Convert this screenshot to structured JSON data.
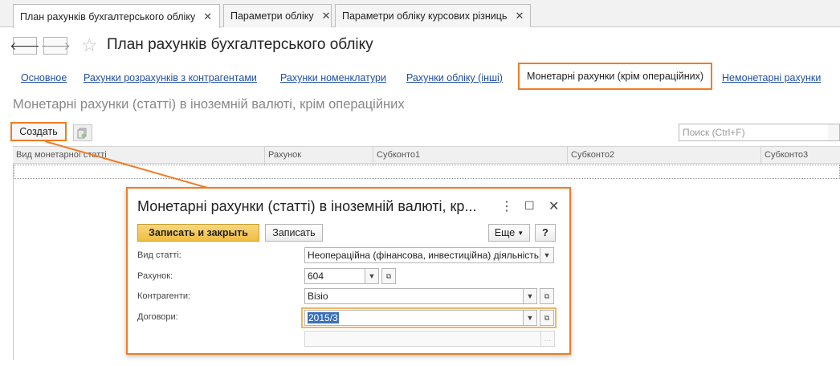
{
  "tabs": [
    {
      "label": "План рахунків бухгалтерського обліку",
      "active": true
    },
    {
      "label": "Параметри обліку",
      "active": false
    },
    {
      "label": "Параметри обліку курсових різниць",
      "active": false
    }
  ],
  "header": {
    "back_icon": "arrow-left-icon",
    "forward_icon": "arrow-right-icon",
    "favorite_icon": "star-icon",
    "title": "План рахунків бухгалтерського обліку"
  },
  "links": [
    "Основное",
    "Рахунки розрахунків з контрагентами",
    "Рахунки номенклатури",
    "Рахунки обліку (інші)",
    "Монетарні рахунки (крім операційних)",
    "Немонетарні рахунки"
  ],
  "section_title": "Монетарні рахунки (статті) в іноземній валюті, крім операційних",
  "toolbar": {
    "create_label": "Создать",
    "search_placeholder": "Поиск (Ctrl+F)"
  },
  "table": {
    "columns": [
      "Вид монетарної статті",
      "Рахунок",
      "Субконто1",
      "Субконто2",
      "Субконто3"
    ]
  },
  "dialog": {
    "title": "Монетарні рахунки (статті) в іноземній валюті, кр...",
    "more_icon": "kebab-menu-icon",
    "maximize_icon": "maximize-icon",
    "close_icon": "close-icon",
    "save_close_label": "Записать и закрыть",
    "save_label": "Записать",
    "more_label": "Еще",
    "help_label": "?",
    "fields": {
      "kind_label": "Вид статті:",
      "kind_value": "Неопераційна (фінансова, инвестиційна) діяльність",
      "account_label": "Рахунок:",
      "account_value": "604",
      "counterparty_label": "Контрагенти:",
      "counterparty_value": "Візіо",
      "contract_label": "Договори:",
      "contract_value": "2015/3"
    }
  },
  "colors": {
    "accent": "#ef7c26",
    "link": "#1f4fa0",
    "primary_button": "#f0bd41"
  }
}
